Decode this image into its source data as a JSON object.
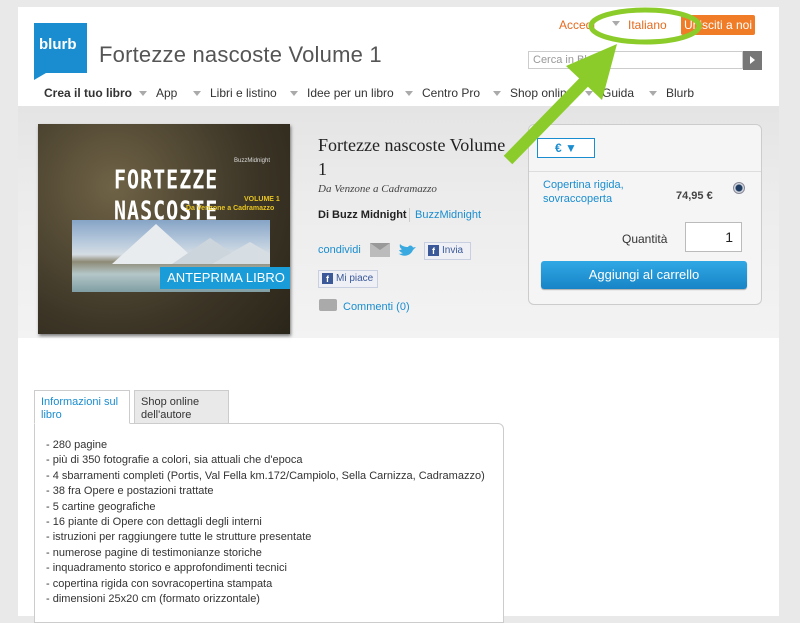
{
  "header": {
    "logo": "blurb",
    "page_title": "Fortezze nascoste Volume 1",
    "login": "Accedi",
    "language": "Italiano",
    "signup": "Unisciti a noi",
    "search_placeholder": "Cerca in Blurb"
  },
  "nav": {
    "items": [
      {
        "label": "Crea il tuo libro"
      },
      {
        "label": "App"
      },
      {
        "label": "Libri e listino"
      },
      {
        "label": "Idee per un libro"
      },
      {
        "label": "Centro Pro"
      },
      {
        "label": "Shop online"
      },
      {
        "label": "Guida"
      },
      {
        "label": "Blurb"
      }
    ]
  },
  "cover": {
    "author": "BuzzMidnight",
    "title": "FORTEZZE NASCOSTE",
    "volume": "VOLUME 1",
    "subtitle": "Da Venzone a Cadramazzo",
    "preview_button": "ANTEPRIMA LIBRO"
  },
  "book": {
    "title": "Fortezze nascoste Volume 1",
    "subtitle": "Da Venzone a Cadramazzo",
    "by": "Di Buzz Midnight",
    "author_link": "BuzzMidnight",
    "share": "condividi",
    "send": "Invia",
    "like": "Mi piace",
    "comments": "Commenti (0)"
  },
  "buy": {
    "currency": "€ ▼",
    "binding": "Copertina rigida, sovraccoperta",
    "price": "74,95 €",
    "qty_label": "Quantità",
    "qty": "1",
    "add_to_cart": "Aggiungi al carrello"
  },
  "tabs": [
    {
      "label": "Informazioni sul libro"
    },
    {
      "label": "Shop online dell'autore"
    }
  ],
  "details": [
    "- 280 pagine",
    "- più di 350 fotografie a colori, sia attuali che d'epoca",
    "- 4 sbarramenti completi (Portis, Val Fella km.172/Campiolo, Sella Carnizza, Cadramazzo)",
    "- 38 fra Opere e postazioni trattate",
    "- 5 cartine geografiche",
    "- 16 piante di Opere con dettagli degli interni",
    "- istruzioni per raggiungere tutte le strutture presentate",
    "- numerose pagine di testimonianze storiche",
    "- inquadramento storico e approfondimenti tecnici",
    "- copertina rigida con sovracopertina stampata",
    "- dimensioni 25x20 cm (formato orizzontale)"
  ],
  "colors": {
    "accent_blue": "#1a8dd0",
    "accent_orange": "#f07c28",
    "annotation_green": "#8ccc2a"
  }
}
